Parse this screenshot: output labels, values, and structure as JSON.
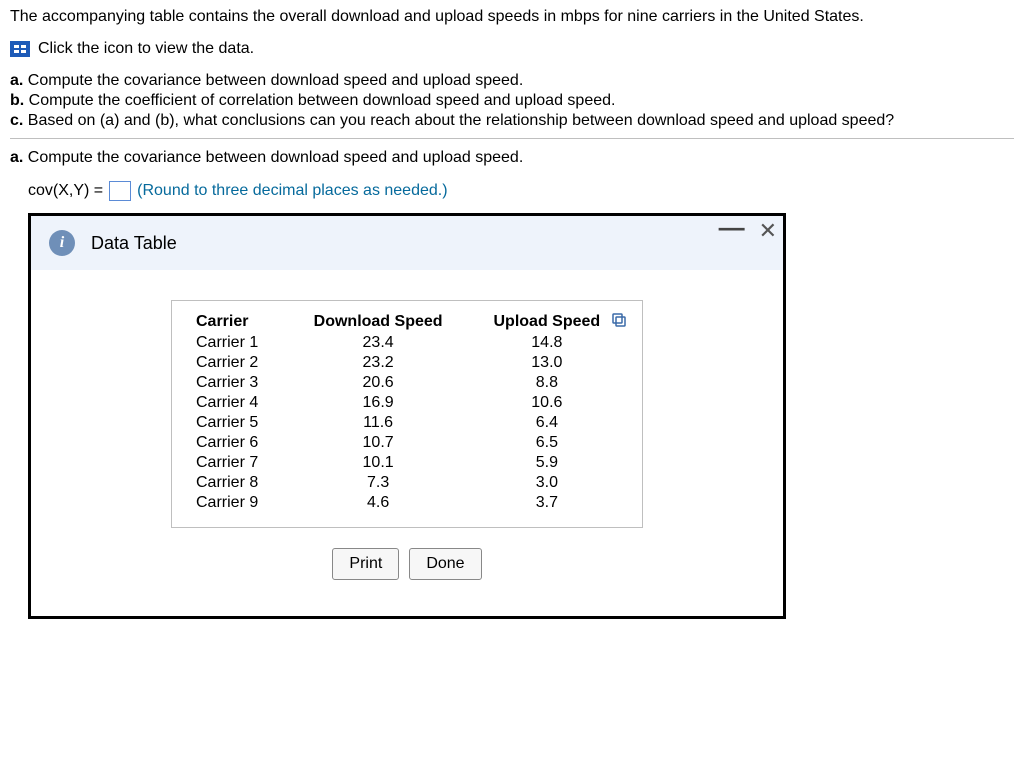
{
  "intro": "The accompanying table contains the overall download and upload speeds in mbps for nine carriers in the United States.",
  "view_data_label": "Click the icon to view the data.",
  "parts": {
    "a": {
      "letter": "a.",
      "text": "Compute the covariance between download speed and upload speed."
    },
    "b": {
      "letter": "b.",
      "text": "Compute the coefficient of correlation between download speed and upload speed."
    },
    "c": {
      "letter": "c.",
      "text": "Based on (a) and (b), what conclusions can you reach about the relationship between download speed and upload speed?"
    }
  },
  "subprompt": {
    "letter": "a.",
    "text": "Compute the covariance between download speed and upload speed."
  },
  "answer": {
    "lhs": "cov(X,Y) =",
    "hint": "(Round to three decimal places as needed.)"
  },
  "modal": {
    "title": "Data Table",
    "print": "Print",
    "done": "Done"
  },
  "table": {
    "headers": {
      "carrier": "Carrier",
      "download": "Download Speed",
      "upload": "Upload Speed"
    },
    "rows": [
      {
        "carrier": "Carrier 1",
        "download": "23.4",
        "upload": "14.8"
      },
      {
        "carrier": "Carrier 2",
        "download": "23.2",
        "upload": "13.0"
      },
      {
        "carrier": "Carrier 3",
        "download": "20.6",
        "upload": "8.8"
      },
      {
        "carrier": "Carrier 4",
        "download": "16.9",
        "upload": "10.6"
      },
      {
        "carrier": "Carrier 5",
        "download": "11.6",
        "upload": "6.4"
      },
      {
        "carrier": "Carrier 6",
        "download": "10.7",
        "upload": "6.5"
      },
      {
        "carrier": "Carrier 7",
        "download": "10.1",
        "upload": "5.9"
      },
      {
        "carrier": "Carrier 8",
        "download": "7.3",
        "upload": "3.0"
      },
      {
        "carrier": "Carrier 9",
        "download": "4.6",
        "upload": "3.7"
      }
    ]
  },
  "chart_data": {
    "type": "table",
    "title": "Download and Upload speeds (mbps) for nine carriers",
    "columns": [
      "Carrier",
      "Download Speed",
      "Upload Speed"
    ],
    "rows": [
      [
        "Carrier 1",
        23.4,
        14.8
      ],
      [
        "Carrier 2",
        23.2,
        13.0
      ],
      [
        "Carrier 3",
        20.6,
        8.8
      ],
      [
        "Carrier 4",
        16.9,
        10.6
      ],
      [
        "Carrier 5",
        11.6,
        6.4
      ],
      [
        "Carrier 6",
        10.7,
        6.5
      ],
      [
        "Carrier 7",
        10.1,
        5.9
      ],
      [
        "Carrier 8",
        7.3,
        3.0
      ],
      [
        "Carrier 9",
        4.6,
        3.7
      ]
    ]
  }
}
